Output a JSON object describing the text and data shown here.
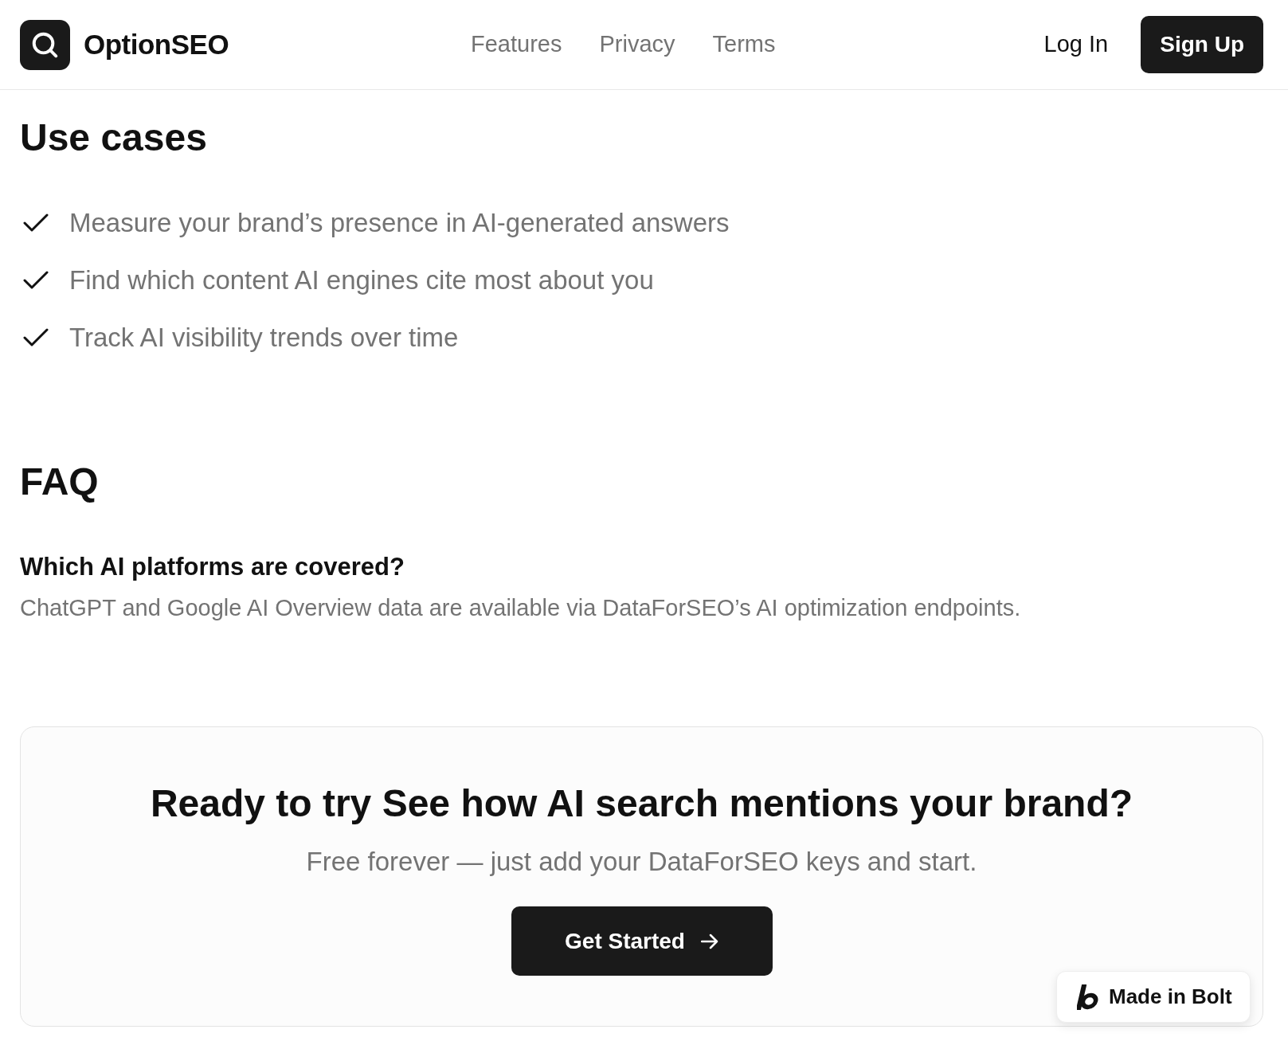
{
  "header": {
    "brand": "OptionSEO",
    "nav": [
      {
        "label": "Features"
      },
      {
        "label": "Privacy"
      },
      {
        "label": "Terms"
      }
    ],
    "login": "Log In",
    "signup": "Sign Up"
  },
  "use_cases": {
    "title": "Use cases",
    "items": [
      "Measure your brand’s presence in AI-generated answers",
      "Find which content AI engines cite most about you",
      "Track AI visibility trends over time"
    ]
  },
  "faq": {
    "title": "FAQ",
    "items": [
      {
        "question": "Which AI platforms are covered?",
        "answer": "ChatGPT and Google AI Overview data are available via DataForSEO’s AI optimization endpoints."
      }
    ]
  },
  "cta": {
    "title": "Ready to try See how AI search mentions your brand?",
    "subtitle": "Free forever — just add your DataForSEO keys and start.",
    "button": "Get Started"
  },
  "badge": {
    "label": "Made in Bolt"
  }
}
